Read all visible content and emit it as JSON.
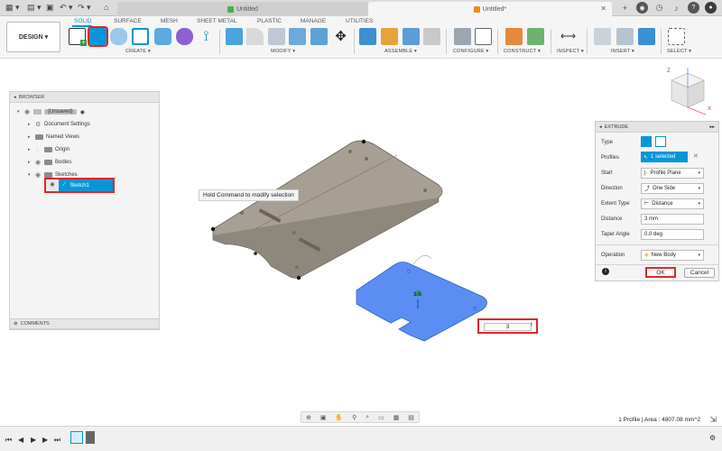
{
  "titlebar": {
    "tab_inactive": "Untitled",
    "tab_active": "Untitled*"
  },
  "toolbar": {
    "design_label": "DESIGN ▾",
    "workspace_tabs": [
      "SOLID",
      "SURFACE",
      "MESH",
      "SHEET METAL",
      "PLASTIC",
      "MANAGE",
      "UTILITIES"
    ],
    "groups": [
      "CREATE ▾",
      "MODIFY ▾",
      "ASSEMBLE ▾",
      "CONFIGURE ▾",
      "CONSTRUCT ▾",
      "INSPECT ▾",
      "INSERT ▾",
      "SELECT ▾"
    ]
  },
  "canvas": {
    "hint": "Hold Command to modify selection",
    "distance_input": "3",
    "dimension_tag": "3.0"
  },
  "browser": {
    "title": "BROWSER",
    "items": [
      "(Unsaved)",
      "Document Settings",
      "Named Views",
      "Origin",
      "Bodies",
      "Sketches",
      "Sketch1"
    ],
    "comments": "COMMENTS"
  },
  "extrude": {
    "title": "EXTRUDE",
    "labels": [
      "Type",
      "Profiles",
      "Start",
      "Direction",
      "Extent Type",
      "Distance",
      "Taper Angle",
      "Operation"
    ],
    "profiles_value": "1 selected",
    "start_value": "Profile Plane",
    "direction_value": "One Side",
    "extent_value": "Distance",
    "distance_value": "3 mm",
    "taper_value": "0.0 deg",
    "operation_value": "New Body",
    "ok_label": "OK",
    "cancel_label": "Cancel"
  },
  "status": {
    "text": "1 Profile | Area : 4807.08 mm^2"
  },
  "colors": {
    "accent": "#0696d7",
    "highlight": "#e0262b",
    "profile_fill": "#5b8df2",
    "body_fill": "#a79f93"
  }
}
